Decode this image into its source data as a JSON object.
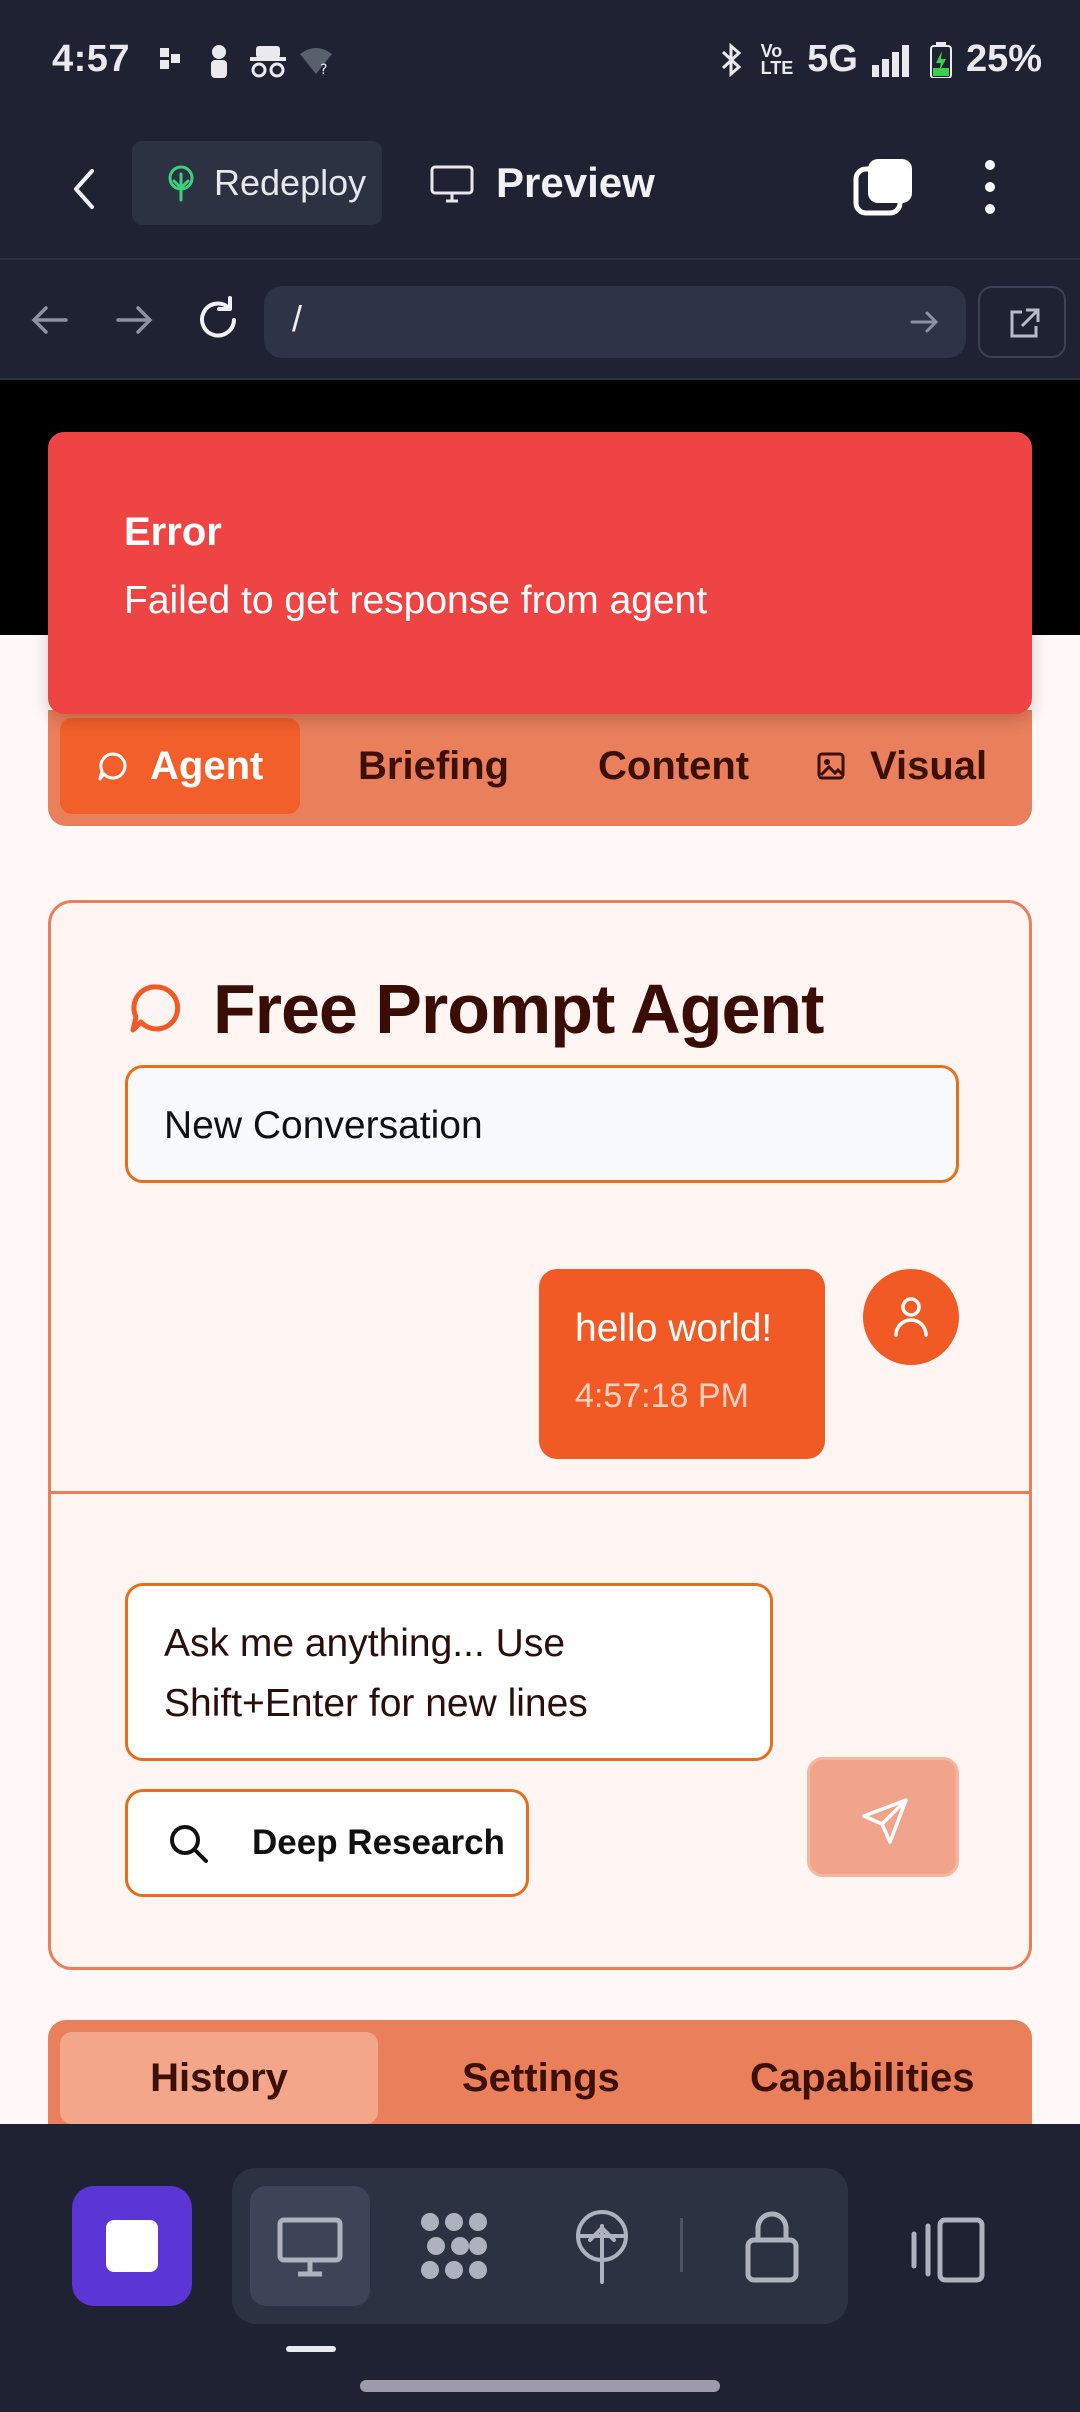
{
  "status_bar": {
    "time": "4:57",
    "network": "5G",
    "battery": "25%"
  },
  "app_bar": {
    "redeploy_label": "Redeploy",
    "preview_label": "Preview"
  },
  "url_bar": {
    "url": "/"
  },
  "error": {
    "title": "Error",
    "message": "Failed to get response from agent"
  },
  "top_tabs": [
    {
      "label": "Agent",
      "active": true
    },
    {
      "label": "Briefing"
    },
    {
      "label": "Content"
    },
    {
      "label": "Visual"
    }
  ],
  "agent": {
    "title": "Free Prompt Agent",
    "conversation_select": "New Conversation",
    "messages": [
      {
        "text": "hello world!",
        "time": "4:57:18 PM",
        "role": "user"
      }
    ],
    "input_placeholder": "Ask me anything... Use Shift+Enter for new lines",
    "deep_research_label": "Deep Research"
  },
  "bottom_tabs": [
    {
      "label": "History",
      "active": true
    },
    {
      "label": "Settings"
    },
    {
      "label": "Capabilities"
    }
  ],
  "colors": {
    "accent": "#f15a24",
    "error": "#ef4444",
    "tab_bar": "#ea7f5c",
    "dock_stop": "#5b35d5"
  },
  "icons": [
    "back-icon",
    "tree-icon",
    "monitor-icon",
    "tabs-icon",
    "more-vert-icon",
    "refresh-icon",
    "chat-bubble-icon",
    "image-icon",
    "user-icon",
    "search-icon",
    "send-icon",
    "lock-icon",
    "antenna-icon",
    "apps-icon"
  ]
}
